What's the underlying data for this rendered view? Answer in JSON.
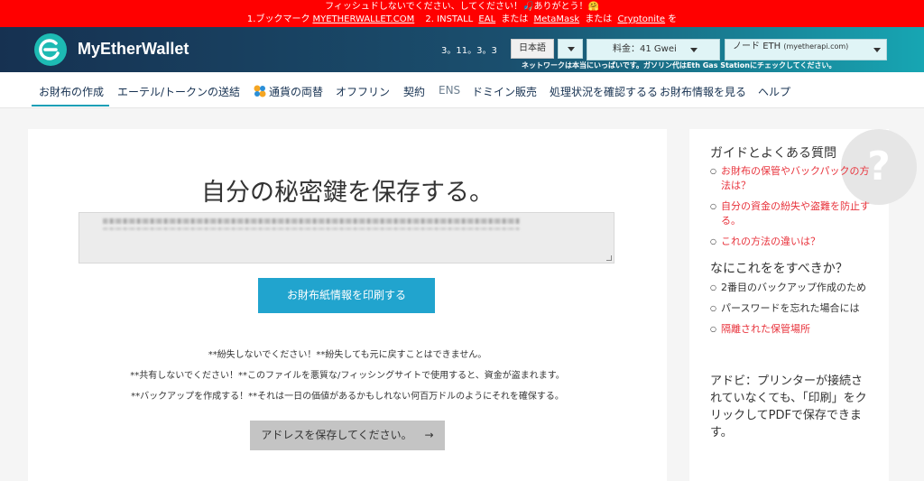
{
  "alert": {
    "line1": "フィッシュドしないでください、してください！🎣ありがとう！🤗",
    "line2_prefix": "1.ブックマーク",
    "line2_site": "MYETHERWALLET.COM",
    "line2_install": "2. INSTALL",
    "line2_eal": "EAL",
    "line2_or1": "または",
    "line2_metamask": "MetaMask",
    "line2_or2": "または",
    "line2_cryptonite": "Cryptonite",
    "line2_suffix": "を"
  },
  "header": {
    "logo_text": "MyEtherWallet",
    "version": "3。11。3。3",
    "language": "日本語",
    "gas_label": "料金：41 Gwei",
    "node_label": "ノード",
    "node_network": "ETH",
    "node_provider": "(myetherapi.com)",
    "network_note": "ネットワークは本当にいっぱいです。ガソリン代はEth Gas Stationにチェックしてください。"
  },
  "nav": {
    "items": [
      "お財布の作成",
      "エーテル/トークンの送結",
      "通貨の両替",
      "オフフリン",
      "契約",
      "ENS",
      "ドミイン販売",
      "処理状況を確認するる",
      "お財布情報を見る",
      "ヘルプ"
    ]
  },
  "main": {
    "title": "自分の秘密鍵を保存する。",
    "print_button": "お財布紙情報を印刷する",
    "warn1": "**紛失しないでください！**紛失しても元に戻すことはできません。",
    "warn2": "**共有しないでください！**このファイルを悪質な/フィッシングサイトで使用すると、資金が盗まれます。",
    "warn3": "**バックアップを作成する！**それは一日の価値があるかもしれない何百万ドルのようにそれを確保する。",
    "save_button": "アドレスを保存してください。",
    "save_arrow": "→"
  },
  "sidebar": {
    "qmark": "?",
    "faq_title": "ガイドとよくある質問",
    "faq_items": [
      "お財布の保管やバックパックの方法は？",
      "自分の資金の紛失や盗難を防止する。",
      "これの方法の違いは？"
    ],
    "todo_title": "なにこれををすべきか？",
    "todo_items": [
      "2番目のバックアップ作成のため",
      "パースワードを忘れた場合には",
      "隔離された保管場所"
    ],
    "note": "アドビ：プリンターが接続されていなくても、「印刷」をクリックしてPDFで保存できます。"
  },
  "colors": {
    "alert_bg": "#ff0000",
    "print_button": "#21a4ce",
    "link_red": "#e8333c",
    "nav_accent": "#1a9fb6"
  }
}
